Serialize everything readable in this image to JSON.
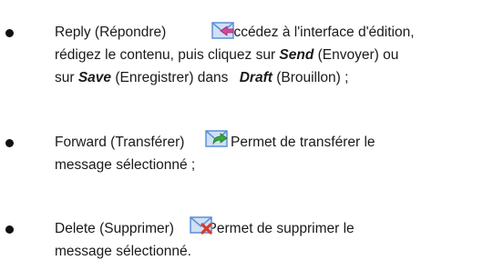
{
  "items": [
    {
      "name": "Reply (Répondre)",
      "icon": "reply-mail-icon",
      "line1_rest": ": Accédez à l'interface d'édition,",
      "line2": "rédigez le contenu, puis cliquez sur ",
      "send_label": "Send",
      "line2_mid": " (Envoyer) ou",
      "line3_pre": "sur ",
      "save_label": "Save",
      "line3_mid": " (Enregistrer) dans ",
      "draft_label": "Draft",
      "line3_post": " (Brouillon) ;"
    },
    {
      "name": "Forward (Transférer)",
      "icon": "forward-mail-icon",
      "line1_rest": ": Permet de transférer le",
      "line2": "message sélectionné ;"
    },
    {
      "name": "Delete (Supprimer)",
      "icon": "delete-mail-icon",
      "line1_rest": ": Permet de supprimer le",
      "line2": "message sélectionné."
    }
  ],
  "colors": {
    "envelope": "#5b8fd6",
    "envelope_light": "#cfe0f7",
    "reply_arrow": "#d24a9a",
    "forward_arrow": "#3aa63a",
    "delete_x": "#d93a2a"
  }
}
